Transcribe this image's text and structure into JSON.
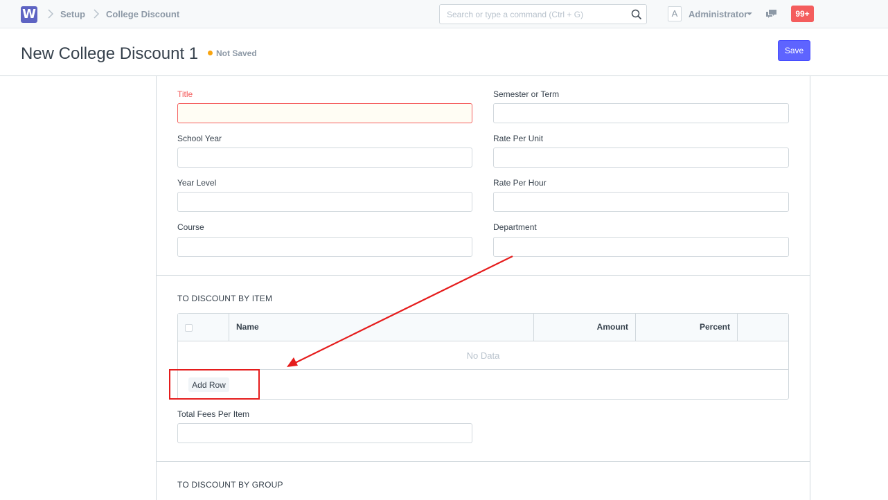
{
  "navbar": {
    "logo_letter": "W",
    "breadcrumbs": [
      "Setup",
      "College Discount"
    ],
    "search_placeholder": "Search or type a command (Ctrl + G)",
    "avatar_letter": "A",
    "user_name": "Administrator",
    "notification_count": "99+"
  },
  "header": {
    "title": "New College Discount 1",
    "status": "Not Saved",
    "save_label": "Save"
  },
  "form": {
    "title_label": "Title",
    "semester_label": "Semester or Term",
    "school_year_label": "School Year",
    "rate_unit_label": "Rate Per Unit",
    "year_level_label": "Year Level",
    "rate_hour_label": "Rate Per Hour",
    "course_label": "Course",
    "department_label": "Department",
    "section_item_title": "TO DISCOUNT BY ITEM",
    "total_fees_label": "Total Fees Per Item",
    "section_group_title": "TO DISCOUNT BY GROUP"
  },
  "grid": {
    "columns": [
      "Name",
      "Amount",
      "Percent"
    ],
    "empty_text": "No Data",
    "add_row_label": "Add Row"
  },
  "colors": {
    "primary": "#5e64ff",
    "required": "#f45d5d",
    "status_dot": "#f8a40f",
    "annotation": "#e51c1c"
  }
}
